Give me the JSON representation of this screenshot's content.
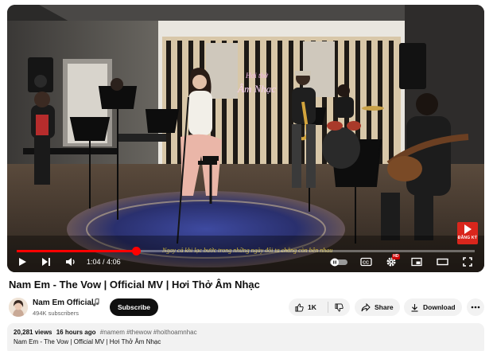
{
  "player": {
    "current_time": "1:04",
    "duration": "4:06",
    "progress_fraction": 0.26,
    "overlay_signboard": "Hoi thở Âm Nhạc",
    "watermark_label": "ĐĂNG KÝ",
    "hd_badge": "HD",
    "caption_text": "Ngay cả khi lạc bước trong những ngày đôi ta chẳng còn bên nhau",
    "accent_color": "#ff0000"
  },
  "video": {
    "title": "Nam Em - The Vow | Official MV | Hơi Thở Âm Nhạc"
  },
  "channel": {
    "name": "Nam Em Official",
    "subscribers": "494K subscribers",
    "subscribe_label": "Subscribe",
    "verified_icon": "music-note-icon"
  },
  "actions": {
    "like_count": "1K",
    "share_label": "Share",
    "download_label": "Download"
  },
  "description": {
    "views": "20,281 views",
    "age": "16 hours ago",
    "tags": "#namem #thewow #hoithoamnhac",
    "text": "Nam Em - The Vow | Official MV | Hơi Thở Âm Nhạc"
  }
}
